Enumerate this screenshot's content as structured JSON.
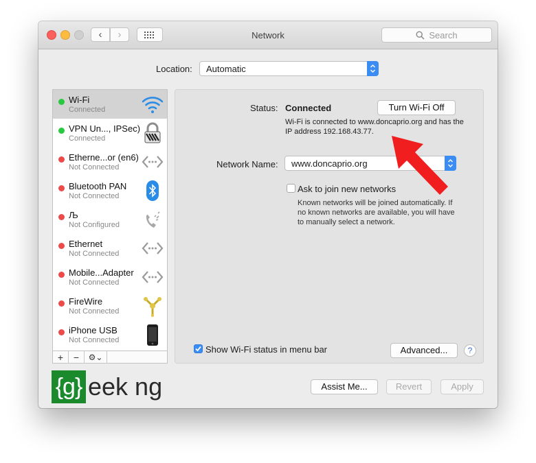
{
  "window": {
    "title": "Network",
    "search_placeholder": "Search"
  },
  "location": {
    "label": "Location:",
    "value": "Automatic"
  },
  "services": [
    {
      "name": "Wi-Fi",
      "status": "Connected",
      "state": "connected",
      "icon": "wifi-icon",
      "selected": true
    },
    {
      "name": "VPN Un..., IPSec)",
      "status": "Connected",
      "state": "connected",
      "icon": "lock-icon",
      "selected": false
    },
    {
      "name": "Etherne...or (en6)",
      "status": "Not Connected",
      "state": "disconnected",
      "icon": "ethernet-icon",
      "selected": false
    },
    {
      "name": "Bluetooth PAN",
      "status": "Not Connected",
      "state": "disconnected",
      "icon": "bluetooth-icon",
      "selected": false
    },
    {
      "name": "Љ",
      "status": "Not Configured",
      "state": "disconnected",
      "icon": "phone-icon",
      "selected": false
    },
    {
      "name": "Ethernet",
      "status": "Not Connected",
      "state": "disconnected",
      "icon": "ethernet-icon",
      "selected": false
    },
    {
      "name": "Mobile...Adapter",
      "status": "Not Connected",
      "state": "disconnected",
      "icon": "ethernet-icon",
      "selected": false
    },
    {
      "name": "FireWire",
      "status": "Not Connected",
      "state": "disconnected",
      "icon": "firewire-icon",
      "selected": false
    },
    {
      "name": "iPhone USB",
      "status": "Not Connected",
      "state": "disconnected",
      "icon": "iphone-icon",
      "selected": false
    }
  ],
  "list_toolbar": {
    "add": "+",
    "remove": "−",
    "gear": "⚙⌄"
  },
  "detail": {
    "status_label": "Status:",
    "status_value": "Connected",
    "turn_off_label": "Turn Wi-Fi Off",
    "status_desc": "Wi-Fi is connected to www.doncaprio.org and has the IP address 192.168.43.77.",
    "network_name_label": "Network Name:",
    "network_name_value": "www.doncaprio.org",
    "ask_label": "Ask to join new networks",
    "ask_desc": "Known networks will be joined automatically. If no known networks are available, you will have to manually select a network.",
    "show_status_label": "Show Wi-Fi status in menu bar",
    "advanced_label": "Advanced...",
    "help_label": "?"
  },
  "bottom": {
    "assist_label": "Assist Me...",
    "revert_label": "Revert",
    "apply_label": "Apply"
  },
  "logo": {
    "box_text": "{g}",
    "text": "eek ng"
  },
  "colors": {
    "connected": "#28c840",
    "disconnected": "#ed4a4a",
    "accent": "#3b8df4",
    "annotation_arrow": "#f01e1e",
    "logo_green": "#1b8a2d"
  }
}
